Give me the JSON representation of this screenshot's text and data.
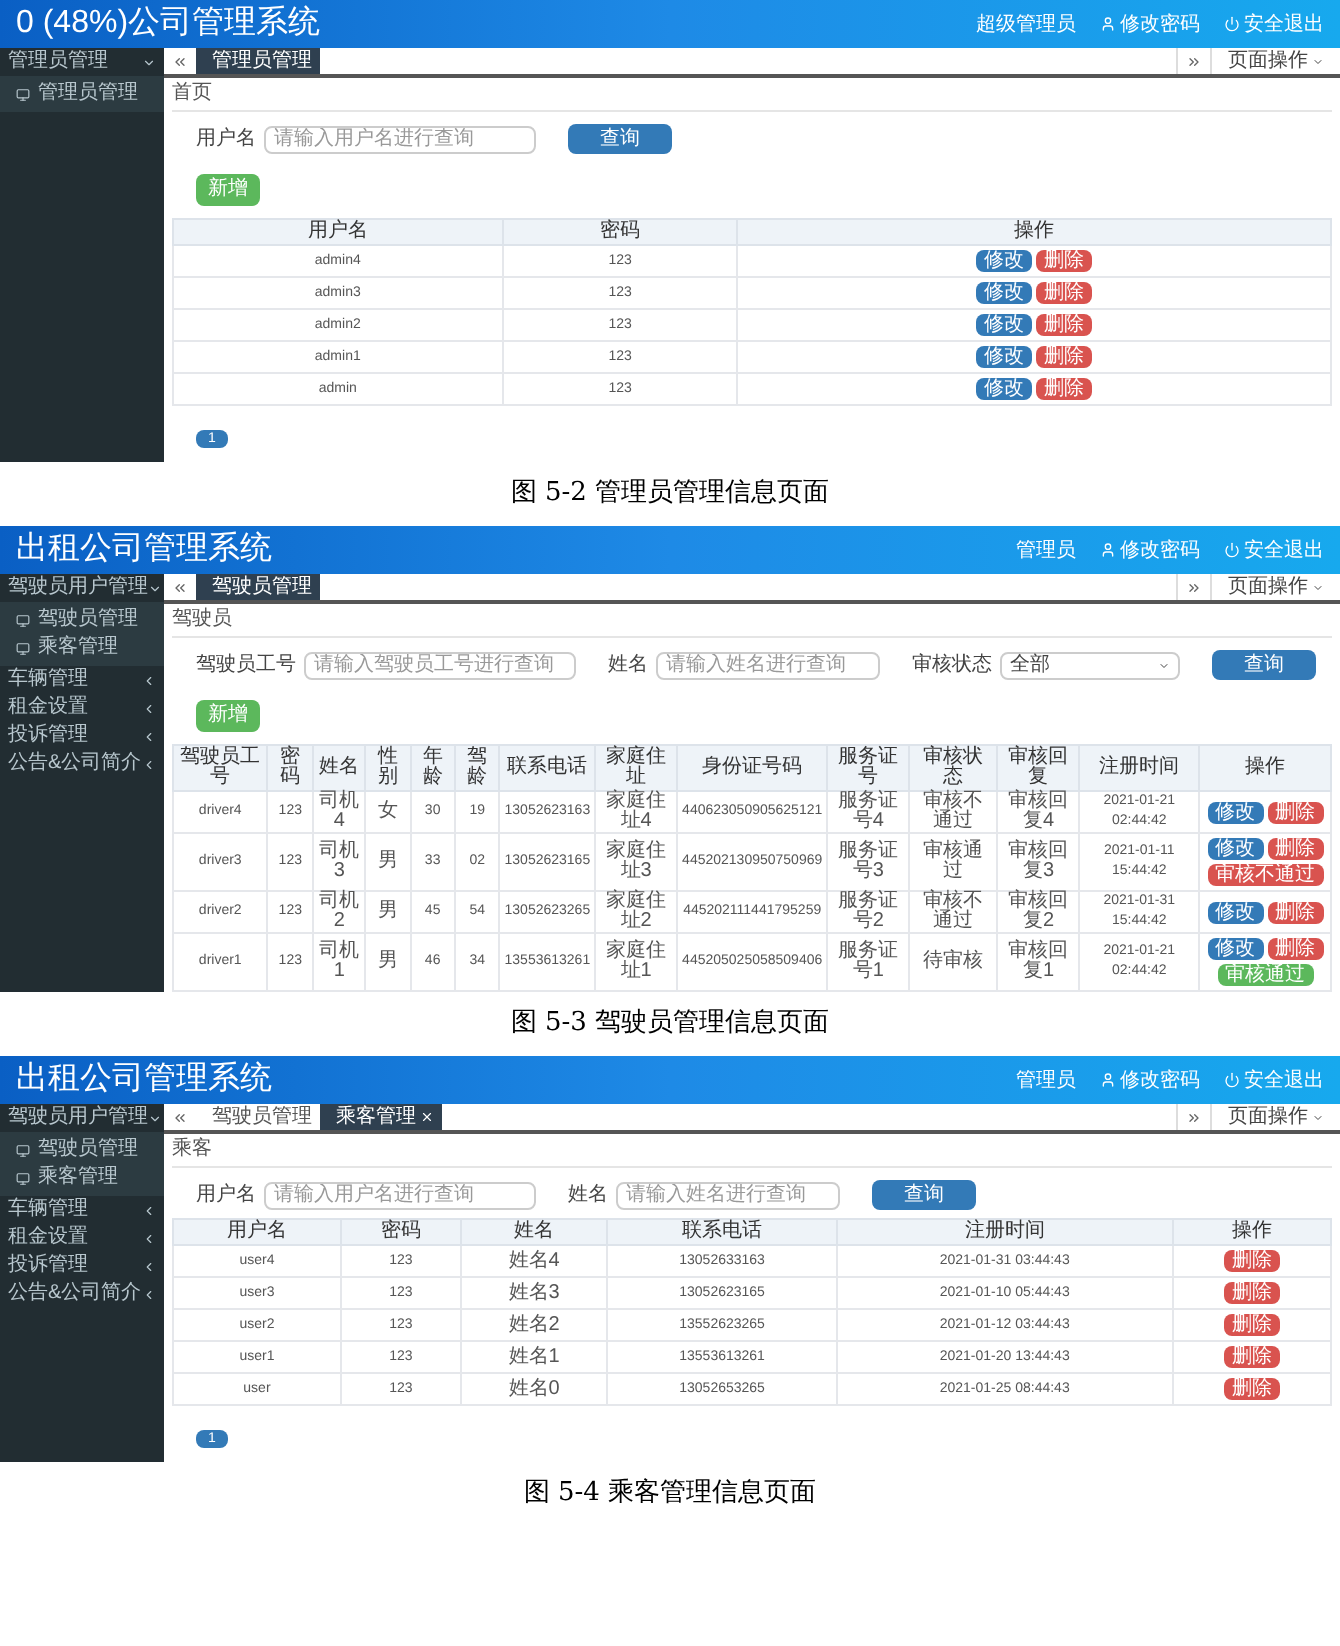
{
  "figures": [
    {
      "screen": {
        "title": "0 (48%)公司管理系统",
        "header_links": [
          {
            "label": "超级管理员",
            "kind": "plain"
          },
          {
            "label": "修改密码",
            "kind": "password"
          },
          {
            "label": "安全退出",
            "kind": "logout"
          }
        ],
        "sidebar": [
          {
            "label": "管理员管理",
            "expanded": true,
            "children": [
              {
                "label": "管理员管理"
              }
            ]
          }
        ],
        "tabs": [
          {
            "label": "管理员管理",
            "selected": true,
            "closable": false
          }
        ],
        "page_menu": "页面操作",
        "breadcrumb": "首页",
        "search": {
          "fields": [
            {
              "kind": "input",
              "label": "用户名",
              "placeholder": "请输入用户名进行查询"
            }
          ],
          "button": "查询"
        },
        "add_button": "新增",
        "table": {
          "columns": [
            "用户名",
            "密码",
            "操作"
          ],
          "rows": [
            {
              "cells": [
                "admin4",
                "123"
              ],
              "actions": [
                {
                  "label": "修改",
                  "kind": "edit"
                },
                {
                  "label": "删除",
                  "kind": "delete"
                }
              ]
            },
            {
              "cells": [
                "admin3",
                "123"
              ],
              "actions": [
                {
                  "label": "修改",
                  "kind": "edit"
                },
                {
                  "label": "删除",
                  "kind": "delete"
                }
              ]
            },
            {
              "cells": [
                "admin2",
                "123"
              ],
              "actions": [
                {
                  "label": "修改",
                  "kind": "edit"
                },
                {
                  "label": "删除",
                  "kind": "delete"
                }
              ]
            },
            {
              "cells": [
                "admin1",
                "123"
              ],
              "actions": [
                {
                  "label": "修改",
                  "kind": "edit"
                },
                {
                  "label": "删除",
                  "kind": "delete"
                }
              ]
            },
            {
              "cells": [
                "admin",
                "123"
              ],
              "actions": [
                {
                  "label": "修改",
                  "kind": "edit"
                },
                {
                  "label": "删除",
                  "kind": "delete"
                }
              ]
            }
          ]
        },
        "pagination": {
          "page": "1"
        }
      },
      "caption": "图 5-2 管理员管理信息页面"
    },
    {
      "screen": {
        "title": "出租公司管理系统",
        "header_links": [
          {
            "label": "管理员",
            "kind": "plain"
          },
          {
            "label": "修改密码",
            "kind": "password"
          },
          {
            "label": "安全退出",
            "kind": "logout"
          }
        ],
        "sidebar": [
          {
            "label": "驾驶员用户管理",
            "expanded": true,
            "children": [
              {
                "label": "驾驶员管理"
              },
              {
                "label": "乘客管理"
              }
            ]
          },
          {
            "label": "车辆管理",
            "expanded": false
          },
          {
            "label": "租金设置",
            "expanded": false
          },
          {
            "label": "投诉管理",
            "expanded": false
          },
          {
            "label": "公告&公司简介",
            "expanded": false
          }
        ],
        "tabs": [
          {
            "label": "驾驶员管理",
            "selected": true,
            "closable": false
          }
        ],
        "page_menu": "页面操作",
        "breadcrumb": "驾驶员",
        "search": {
          "fields": [
            {
              "kind": "input",
              "label": "驾驶员工号",
              "placeholder": "请输入驾驶员工号进行查询"
            },
            {
              "kind": "input",
              "label": "姓名",
              "placeholder": "请输入姓名进行查询"
            },
            {
              "kind": "select",
              "label": "审核状态",
              "value": "全部"
            }
          ],
          "button": "查询"
        },
        "add_button": "新增",
        "table": {
          "columns": [
            "驾驶员工号",
            "密码",
            "姓名",
            "性别",
            "年龄",
            "驾龄",
            "联系电话",
            "家庭住址",
            "身份证号码",
            "服务证号",
            "审核状态",
            "审核回复",
            "注册时间",
            "操作"
          ],
          "rows": [
            {
              "cells": [
                "driver4",
                "123",
                "司机4",
                "女",
                "30",
                "19",
                "13052623163",
                "家庭住址4",
                "440623050905625121",
                "服务证号4",
                "审核不通过",
                "审核回复4",
                "2021-01-21 02:44:42"
              ],
              "actions": [
                {
                  "label": "修改",
                  "kind": "edit"
                },
                {
                  "label": "删除",
                  "kind": "delete"
                }
              ]
            },
            {
              "cells": [
                "driver3",
                "123",
                "司机3",
                "男",
                "33",
                "02",
                "13052623165",
                "家庭住址3",
                "445202130950750969",
                "服务证号3",
                "审核通过",
                "审核回复3",
                "2021-01-11 15:44:42"
              ],
              "actions": [
                {
                  "label": "修改",
                  "kind": "edit"
                },
                {
                  "label": "删除",
                  "kind": "delete"
                },
                {
                  "label": "审核不通过",
                  "kind": "reject"
                }
              ]
            },
            {
              "cells": [
                "driver2",
                "123",
                "司机2",
                "男",
                "45",
                "54",
                "13052623265",
                "家庭住址2",
                "445202111441795259",
                "服务证号2",
                "审核不通过",
                "审核回复2",
                "2021-01-31 15:44:42"
              ],
              "actions": [
                {
                  "label": "修改",
                  "kind": "edit"
                },
                {
                  "label": "删除",
                  "kind": "delete"
                }
              ]
            },
            {
              "cells": [
                "driver1",
                "123",
                "司机1",
                "男",
                "46",
                "34",
                "13553613261",
                "家庭住址1",
                "445205025058509406",
                "服务证号1",
                "待审核",
                "审核回复1",
                "2021-01-21 02:44:42"
              ],
              "actions": [
                {
                  "label": "修改",
                  "kind": "edit"
                },
                {
                  "label": "删除",
                  "kind": "delete"
                },
                {
                  "label": "审核通过",
                  "kind": "approve"
                }
              ]
            }
          ]
        }
      },
      "caption": "图 5-3 驾驶员管理信息页面"
    },
    {
      "screen": {
        "title": "出租公司管理系统",
        "header_links": [
          {
            "label": "管理员",
            "kind": "plain"
          },
          {
            "label": "修改密码",
            "kind": "password"
          },
          {
            "label": "安全退出",
            "kind": "logout"
          }
        ],
        "sidebar": [
          {
            "label": "驾驶员用户管理",
            "expanded": true,
            "children": [
              {
                "label": "驾驶员管理"
              },
              {
                "label": "乘客管理"
              }
            ]
          },
          {
            "label": "车辆管理",
            "expanded": false
          },
          {
            "label": "租金设置",
            "expanded": false
          },
          {
            "label": "投诉管理",
            "expanded": false
          },
          {
            "label": "公告&公司简介",
            "expanded": false
          }
        ],
        "tabs": [
          {
            "label": "驾驶员管理",
            "selected": false,
            "closable": false
          },
          {
            "label": "乘客管理",
            "selected": true,
            "closable": true
          }
        ],
        "page_menu": "页面操作",
        "breadcrumb": "乘客",
        "search": {
          "fields": [
            {
              "kind": "input",
              "label": "用户名",
              "placeholder": "请输入用户名进行查询"
            },
            {
              "kind": "input",
              "label": "姓名",
              "placeholder": "请输入姓名进行查询"
            }
          ],
          "button": "查询"
        },
        "table": {
          "columns": [
            "用户名",
            "密码",
            "姓名",
            "联系电话",
            "注册时间",
            "操作"
          ],
          "rows": [
            {
              "cells": [
                "user4",
                "123",
                "姓名4",
                "13052633163",
                "2021-01-31 03:44:43"
              ],
              "actions": [
                {
                  "label": "删除",
                  "kind": "delete"
                }
              ]
            },
            {
              "cells": [
                "user3",
                "123",
                "姓名3",
                "13052623165",
                "2021-01-10 05:44:43"
              ],
              "actions": [
                {
                  "label": "删除",
                  "kind": "delete"
                }
              ]
            },
            {
              "cells": [
                "user2",
                "123",
                "姓名2",
                "13552623265",
                "2021-01-12 03:44:43"
              ],
              "actions": [
                {
                  "label": "删除",
                  "kind": "delete"
                }
              ]
            },
            {
              "cells": [
                "user1",
                "123",
                "姓名1",
                "13553613261",
                "2021-01-20 13:44:43"
              ],
              "actions": [
                {
                  "label": "删除",
                  "kind": "delete"
                }
              ]
            },
            {
              "cells": [
                "user",
                "123",
                "姓名0",
                "13052653265",
                "2021-01-25 08:44:43"
              ],
              "actions": [
                {
                  "label": "删除",
                  "kind": "delete"
                }
              ]
            }
          ]
        },
        "pagination": {
          "page": "1"
        }
      },
      "caption": "图 5-4 乘客管理信息页面"
    }
  ]
}
